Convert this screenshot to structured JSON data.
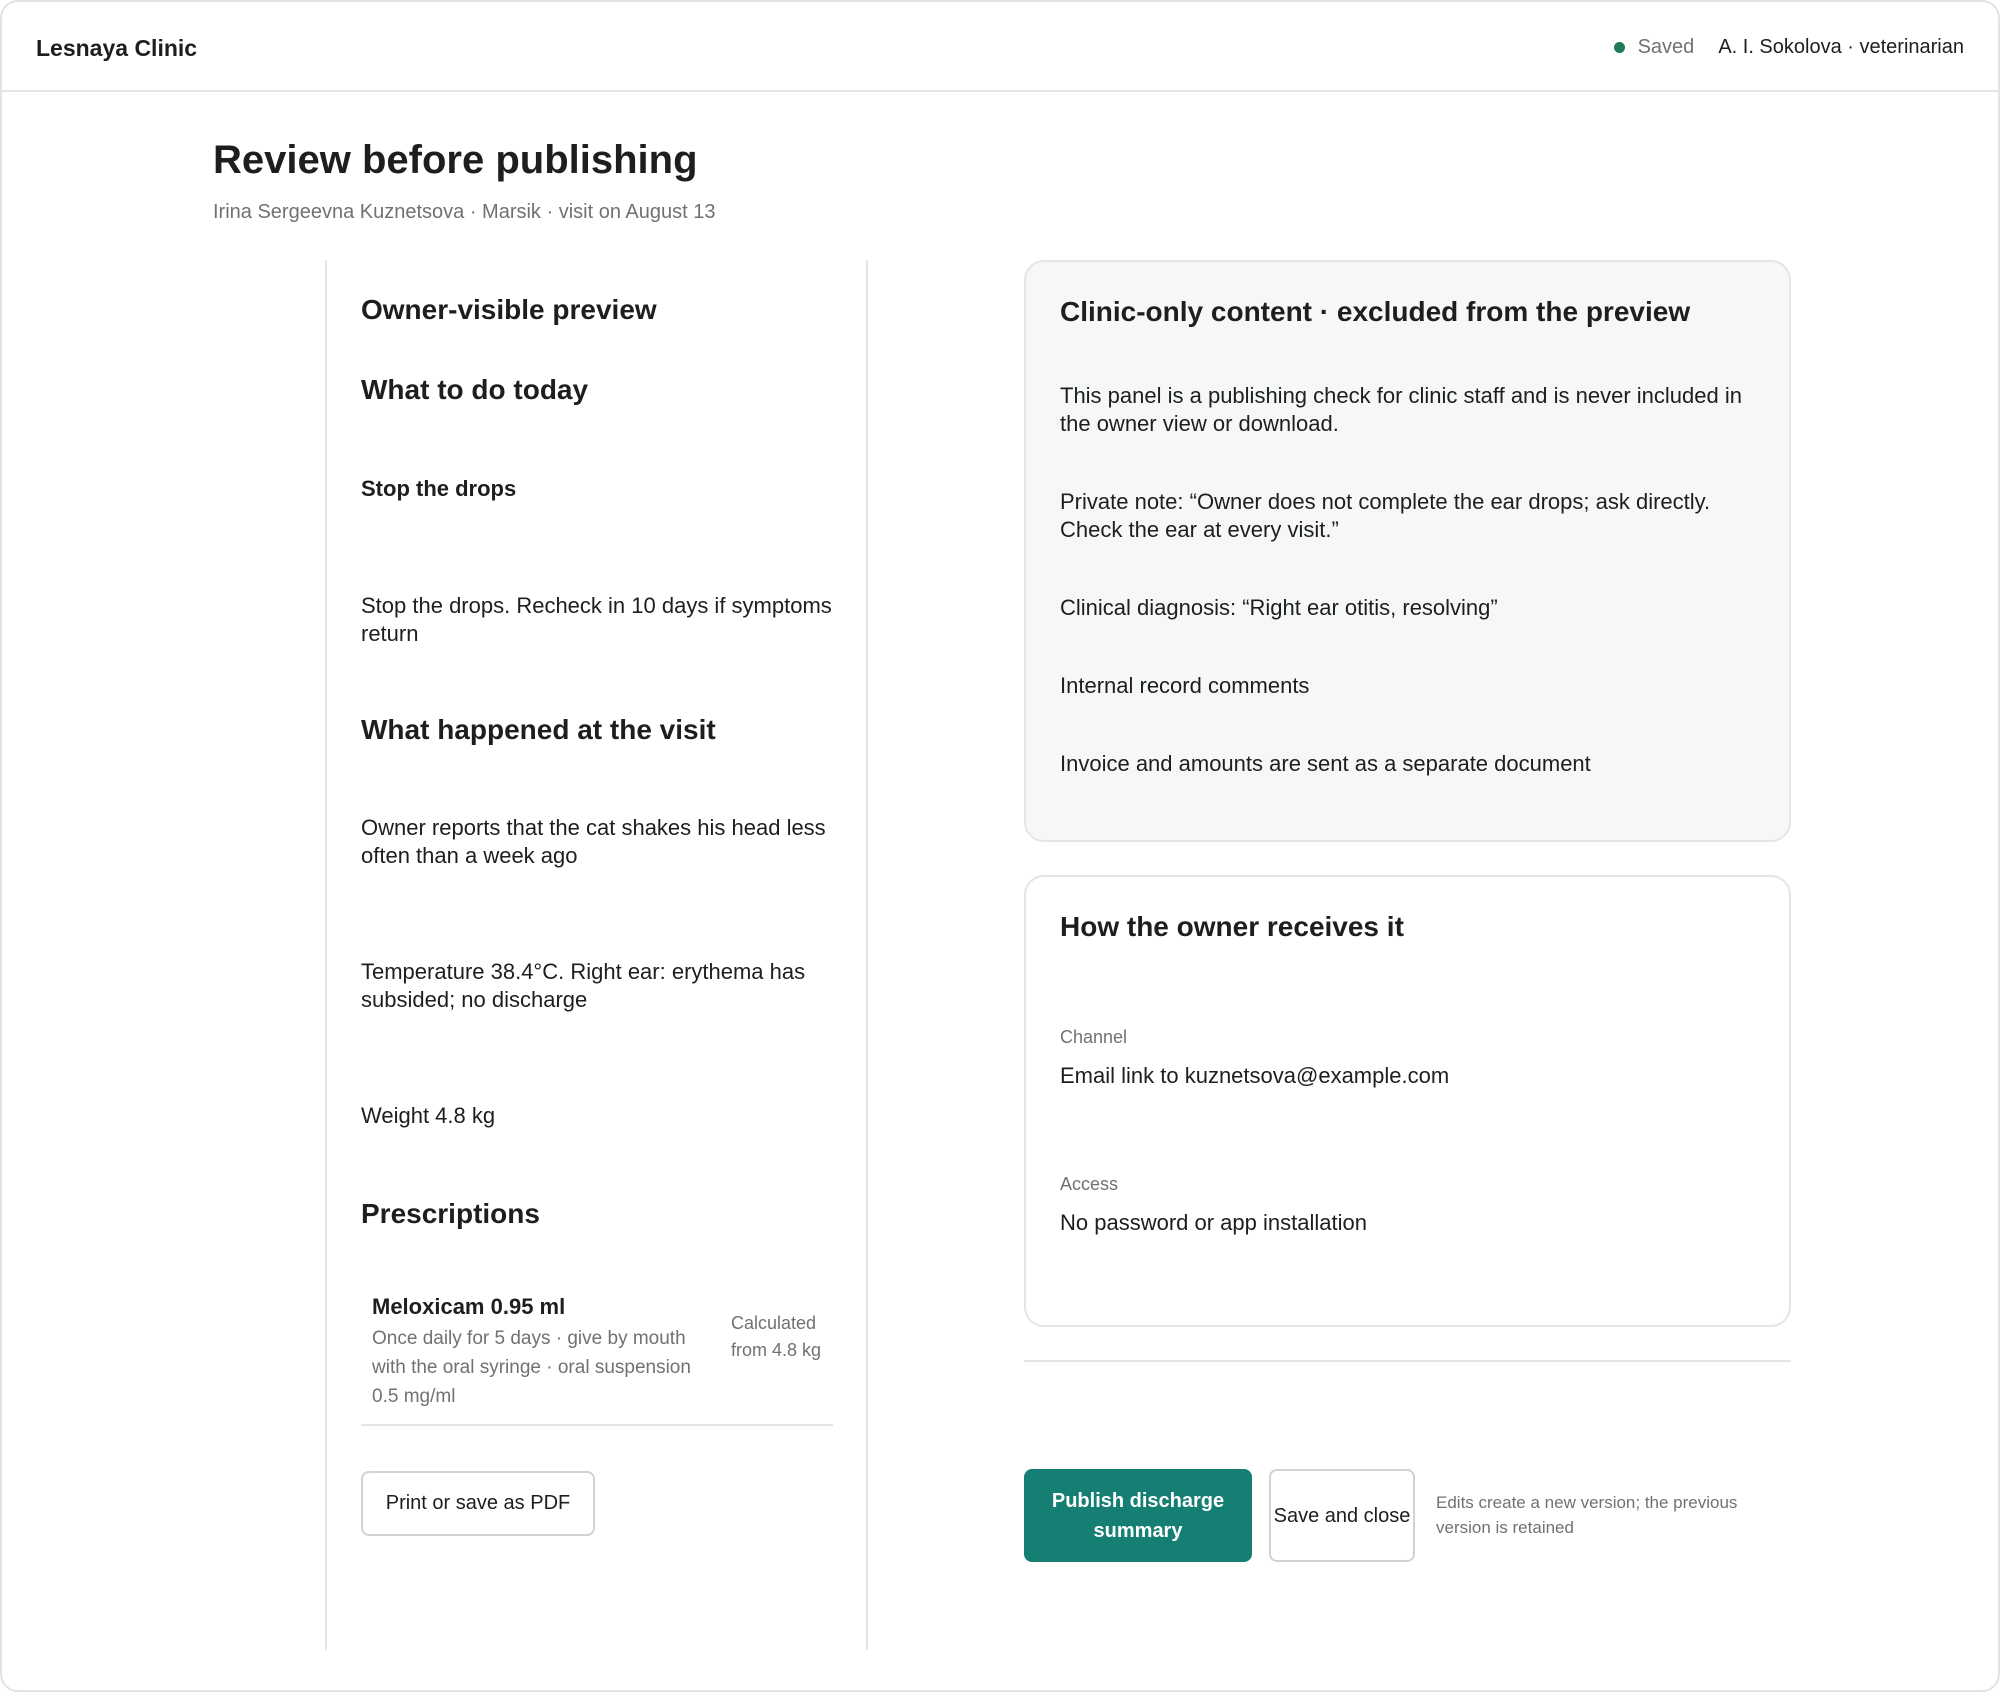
{
  "header": {
    "brand": "Lesnaya Clinic",
    "status": "Saved",
    "user": "A. I. Sokolova · veterinarian"
  },
  "page": {
    "title": "Review before publishing",
    "subtitle": "Irina Sergeevna Kuznetsova · Marsik · visit on August 13"
  },
  "preview": {
    "heading": "Owner-visible preview",
    "today_heading": "What to do today",
    "today_bold": "Stop the drops",
    "today_text": "Stop the drops. Recheck in 10 days if symptoms return",
    "visit_heading": "What happened at the visit",
    "visit_items": [
      "Owner reports that the cat shakes his head less often than a week ago",
      "Temperature 38.4°C. Right ear: erythema has subsided; no discharge",
      "Weight 4.8 kg"
    ],
    "prescriptions_heading": "Prescriptions",
    "prescription": {
      "name": "Meloxicam 0.95 ml",
      "description": "Once daily for 5 days · give by mouth with the oral syringe · oral suspension 0.5 mg/ml",
      "calculation": "Calculated from 4.8 kg"
    },
    "print_button": "Print or save as PDF"
  },
  "clinic_only": {
    "title": "Clinic-only content · excluded from the preview",
    "items": [
      "This panel is a publishing check for clinic staff and is never included in the owner view or download.",
      "Private note: “Owner does not complete the ear drops; ask directly. Check the ear at every visit.”",
      "Clinical diagnosis: “Right ear otitis, resolving”",
      "Internal record comments",
      "Invoice and amounts are sent as a separate document"
    ]
  },
  "delivery": {
    "title": "How the owner receives it",
    "channel_label": "Channel",
    "channel_value": "Email link to kuznetsova@example.com",
    "access_label": "Access",
    "access_value": "No password or app installation"
  },
  "actions": {
    "publish": "Publish discharge summary",
    "save_close": "Save and close",
    "note": "Edits create a new version; the previous version is retained"
  },
  "colors": {
    "accent": "#167f74",
    "status_dot": "#1f7a55",
    "panel_gray": "#f6f7f7"
  }
}
